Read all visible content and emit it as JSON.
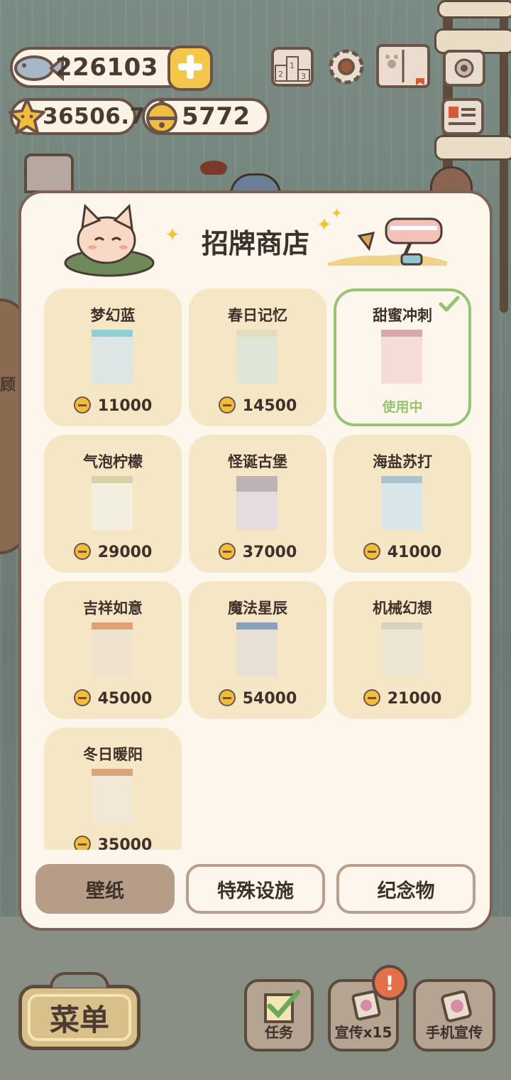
{
  "hud": {
    "fish_amount": "226103",
    "star_amount": "36506.7",
    "bell_amount": "5772",
    "colors": {
      "accent": "#f4c64a",
      "outline": "#6b5447"
    }
  },
  "background": {
    "side_sign": "顾"
  },
  "shop": {
    "title": "招牌商店",
    "in_use_label": "使用中",
    "items": [
      {
        "name": "梦幻蓝",
        "price": "11000",
        "rail": "#8fd0d6",
        "fill": "#dde6e4"
      },
      {
        "name": "春日记忆",
        "price": "14500",
        "rail": "#e3dcc0",
        "fill": "#dfe6d8"
      },
      {
        "name": "甜蜜冲刺",
        "price": "",
        "rail": "#d9a8aa",
        "fill": "#f5dcd8",
        "active": true
      },
      {
        "name": "气泡柠檬",
        "price": "29000",
        "rail": "#d8d1a5",
        "fill": "#f2efde"
      },
      {
        "name": "怪诞古堡",
        "price": "37000",
        "rail": "#bdb3b5",
        "fill": "#e4dcde"
      },
      {
        "name": "海盐苏打",
        "price": "41000",
        "rail": "#a9c4cc",
        "fill": "#d8e6ea"
      },
      {
        "name": "吉祥如意",
        "price": "45000",
        "rail": "#e0a078",
        "fill": "#efe2cf"
      },
      {
        "name": "魔法星辰",
        "price": "54000",
        "rail": "#8aa0bf",
        "fill": "#e6e0d6"
      },
      {
        "name": "机械幻想",
        "price": "21000",
        "rail": "#d6d2c0",
        "fill": "#eee6d4"
      },
      {
        "name": "冬日暖阳",
        "price": "35000",
        "rail": "#d8a47a",
        "fill": "#f2e8d6"
      }
    ],
    "tabs": [
      "壁纸",
      "特殊设施",
      "纪念物"
    ],
    "colors": {
      "card": "#f5e6c5",
      "active_border": "#9bc274",
      "tab_selected": "#b59d88"
    }
  },
  "bottom": {
    "menu_label": "菜单",
    "task_label": "任务",
    "promo_label": "宣传x15",
    "phone_promo_label": "手机宣传",
    "alert_badge": "!"
  }
}
